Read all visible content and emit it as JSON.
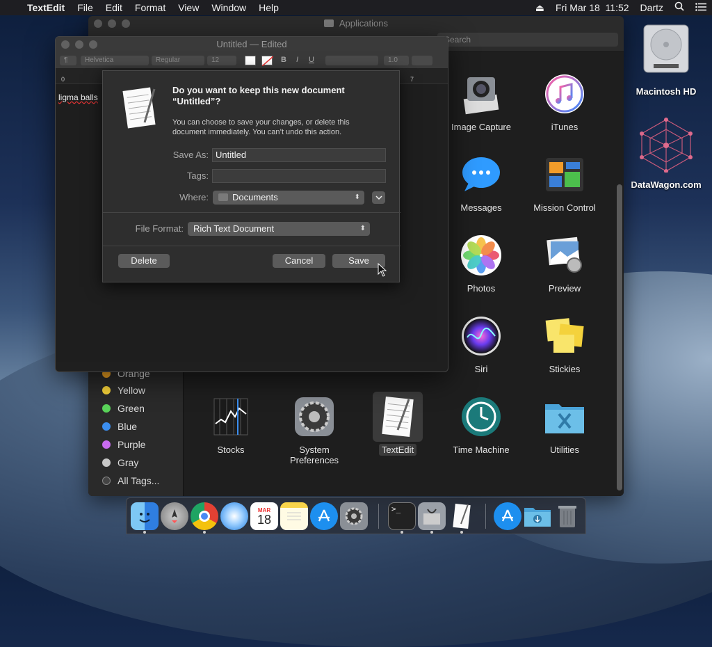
{
  "menubar": {
    "apple_glyph": "",
    "app": "TextEdit",
    "items": [
      "File",
      "Edit",
      "Format",
      "View",
      "Window",
      "Help"
    ],
    "eject_glyph": "⏏",
    "clock": "Fri Mar 18  11:52",
    "user": "Dartz"
  },
  "desktop": {
    "icons": [
      {
        "label": "Macintosh HD",
        "icon": "hard-drive-icon"
      },
      {
        "label": "DataWagon.com",
        "icon": "molecule-graphic-icon"
      }
    ]
  },
  "finder": {
    "title": "Applications",
    "search_placeholder": "Search",
    "tags": [
      {
        "label": "Orange",
        "color": "#f5a623"
      },
      {
        "label": "Yellow",
        "color": "#f8d43a"
      },
      {
        "label": "Green",
        "color": "#5ad45a"
      },
      {
        "label": "Blue",
        "color": "#3b8ef0"
      },
      {
        "label": "Purple",
        "color": "#c86bf0"
      },
      {
        "label": "Gray",
        "color": "#c8c8c8"
      },
      {
        "label": "All Tags..."
      }
    ],
    "apps": [
      {
        "label": "Image Capture",
        "icon": "camera-icon"
      },
      {
        "label": "iTunes",
        "icon": "music-note-icon"
      },
      {
        "label": "Messages",
        "icon": "speech-bubble-icon"
      },
      {
        "label": "Mission Control",
        "icon": "mission-control-icon"
      },
      {
        "label": "Photos",
        "icon": "photos-flower-icon"
      },
      {
        "label": "Preview",
        "icon": "preview-icon"
      },
      {
        "label": "Siri",
        "icon": "siri-icon"
      },
      {
        "label": "Stickies",
        "icon": "stickies-icon"
      },
      {
        "label": "Stocks",
        "icon": "stocks-chart-icon"
      },
      {
        "label": "System Preferences",
        "icon": "gear-icon"
      },
      {
        "label": "TextEdit",
        "icon": "textedit-document-icon"
      },
      {
        "label": "Time Machine",
        "icon": "time-machine-icon"
      },
      {
        "label": "Utilities",
        "icon": "utilities-folder-icon"
      }
    ]
  },
  "textedit": {
    "title": "Untitled",
    "title_sep": "—",
    "title_status": "Edited",
    "format": {
      "paragraph": "¶",
      "font": "Helvetica",
      "style": "Regular",
      "size": "12",
      "line_spacing": "1.0"
    },
    "ruler_marks": [
      "0",
      "7"
    ],
    "document_text": "ligma balls"
  },
  "sheet": {
    "heading": "Do you want to keep this new document “Untitled”?",
    "body": "You can choose to save your changes, or delete this document immediately. You can’t undo this action.",
    "save_as_label": "Save As:",
    "save_as_value": "Untitled",
    "tags_label": "Tags:",
    "where_label": "Where:",
    "where_value": "Documents",
    "file_format_label": "File Format:",
    "file_format_value": "Rich Text Document",
    "delete_label": "Delete",
    "cancel_label": "Cancel",
    "save_label": "Save"
  },
  "dock": {
    "apps": [
      "Finder",
      "Launchpad",
      "Chrome",
      "Safari",
      "Calendar",
      "Notes",
      "App Store",
      "System Preferences",
      "Terminal",
      "Disk Utility",
      "TextEdit",
      "App Store Downloads",
      "Downloads",
      "Trash"
    ],
    "calendar_month": "MAR",
    "calendar_day": "18"
  }
}
